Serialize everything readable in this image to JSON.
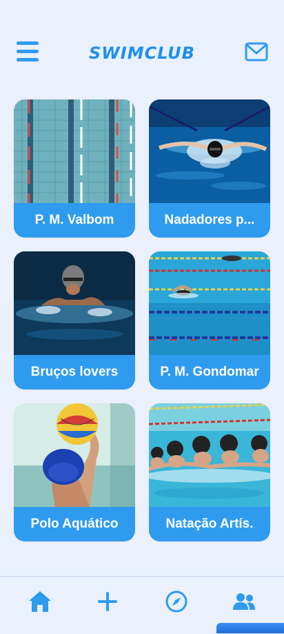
{
  "header": {
    "title": "SWIMCLUB",
    "menu_icon": "hamburger-menu-icon",
    "mail_icon": "envelope-icon"
  },
  "groups": [
    {
      "label": "P. M. Valbom"
    },
    {
      "label": "Nadadores p..."
    },
    {
      "label": "Bruços lovers"
    },
    {
      "label": "P. M. Gondomar"
    },
    {
      "label": "Polo Aquático"
    },
    {
      "label": "Natação Artís."
    }
  ],
  "tabbar": {
    "tabs": [
      "home-icon",
      "plus-icon",
      "compass-icon",
      "people-icon"
    ]
  },
  "colors": {
    "accent": "#2f9bef",
    "background": "#eaf0fc"
  }
}
